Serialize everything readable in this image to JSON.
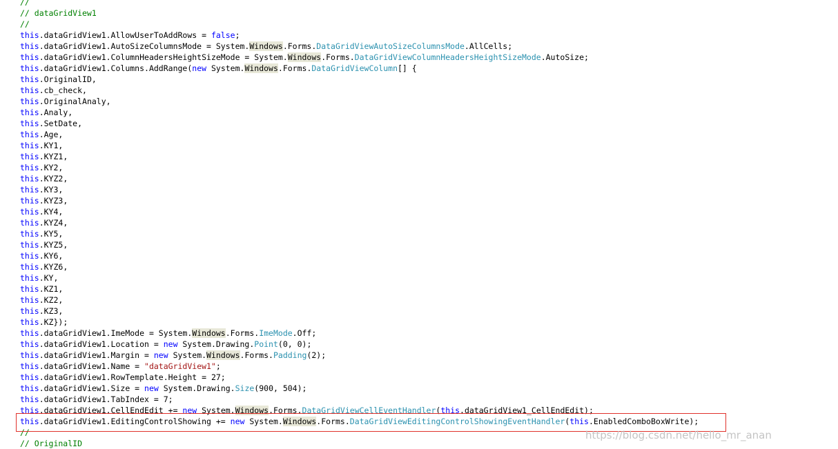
{
  "code": {
    "lines": [
      [
        [
          "cm",
          "//"
        ]
      ],
      [
        [
          "cm",
          "// dataGridView1"
        ]
      ],
      [
        [
          "cm",
          "//"
        ]
      ],
      [
        [
          "kw",
          "this"
        ],
        [
          "",
          ".dataGridView1.AllowUserToAddRows = "
        ],
        [
          "kw",
          "false"
        ],
        [
          "",
          ";"
        ]
      ],
      [
        [
          "kw",
          "this"
        ],
        [
          "",
          ".dataGridView1.AutoSizeColumnsMode = System."
        ],
        [
          "hl",
          "Windows"
        ],
        [
          "",
          ".Forms."
        ],
        [
          "ty",
          "DataGridViewAutoSizeColumnsMode"
        ],
        [
          "",
          ".AllCells;"
        ]
      ],
      [
        [
          "kw",
          "this"
        ],
        [
          "",
          ".dataGridView1.ColumnHeadersHeightSizeMode = System."
        ],
        [
          "hl",
          "Windows"
        ],
        [
          "",
          ".Forms."
        ],
        [
          "ty",
          "DataGridViewColumnHeadersHeightSizeMode"
        ],
        [
          "",
          ".AutoSize;"
        ]
      ],
      [
        [
          "kw",
          "this"
        ],
        [
          "",
          ".dataGridView1.Columns.AddRange("
        ],
        [
          "kw",
          "new"
        ],
        [
          "",
          " System."
        ],
        [
          "hl",
          "Windows"
        ],
        [
          "",
          ".Forms."
        ],
        [
          "ty",
          "DataGridViewColumn"
        ],
        [
          "",
          "[] {"
        ]
      ],
      [
        [
          "kw",
          "this"
        ],
        [
          "",
          ".OriginalID,"
        ]
      ],
      [
        [
          "kw",
          "this"
        ],
        [
          "",
          ".cb_check,"
        ]
      ],
      [
        [
          "kw",
          "this"
        ],
        [
          "",
          ".OriginalAnaly,"
        ]
      ],
      [
        [
          "kw",
          "this"
        ],
        [
          "",
          ".Analy,"
        ]
      ],
      [
        [
          "kw",
          "this"
        ],
        [
          "",
          ".SetDate,"
        ]
      ],
      [
        [
          "kw",
          "this"
        ],
        [
          "",
          ".Age,"
        ]
      ],
      [
        [
          "kw",
          "this"
        ],
        [
          "",
          ".KY1,"
        ]
      ],
      [
        [
          "kw",
          "this"
        ],
        [
          "",
          ".KYZ1,"
        ]
      ],
      [
        [
          "kw",
          "this"
        ],
        [
          "",
          ".KY2,"
        ]
      ],
      [
        [
          "kw",
          "this"
        ],
        [
          "",
          ".KYZ2,"
        ]
      ],
      [
        [
          "kw",
          "this"
        ],
        [
          "",
          ".KY3,"
        ]
      ],
      [
        [
          "kw",
          "this"
        ],
        [
          "",
          ".KYZ3,"
        ]
      ],
      [
        [
          "kw",
          "this"
        ],
        [
          "",
          ".KY4,"
        ]
      ],
      [
        [
          "kw",
          "this"
        ],
        [
          "",
          ".KYZ4,"
        ]
      ],
      [
        [
          "kw",
          "this"
        ],
        [
          "",
          ".KY5,"
        ]
      ],
      [
        [
          "kw",
          "this"
        ],
        [
          "",
          ".KYZ5,"
        ]
      ],
      [
        [
          "kw",
          "this"
        ],
        [
          "",
          ".KY6,"
        ]
      ],
      [
        [
          "kw",
          "this"
        ],
        [
          "",
          ".KYZ6,"
        ]
      ],
      [
        [
          "kw",
          "this"
        ],
        [
          "",
          ".KY,"
        ]
      ],
      [
        [
          "kw",
          "this"
        ],
        [
          "",
          ".KZ1,"
        ]
      ],
      [
        [
          "kw",
          "this"
        ],
        [
          "",
          ".KZ2,"
        ]
      ],
      [
        [
          "kw",
          "this"
        ],
        [
          "",
          ".KZ3,"
        ]
      ],
      [
        [
          "kw",
          "this"
        ],
        [
          "",
          ".KZ});"
        ]
      ],
      [
        [
          "kw",
          "this"
        ],
        [
          "",
          ".dataGridView1.ImeMode = System."
        ],
        [
          "hl",
          "Windows"
        ],
        [
          "",
          ".Forms."
        ],
        [
          "ty",
          "ImeMode"
        ],
        [
          "",
          ".Off;"
        ]
      ],
      [
        [
          "kw",
          "this"
        ],
        [
          "",
          ".dataGridView1.Location = "
        ],
        [
          "kw",
          "new"
        ],
        [
          "",
          " System.Drawing."
        ],
        [
          "ty",
          "Point"
        ],
        [
          "",
          "(0, 0);"
        ]
      ],
      [
        [
          "kw",
          "this"
        ],
        [
          "",
          ".dataGridView1.Margin = "
        ],
        [
          "kw",
          "new"
        ],
        [
          "",
          " System."
        ],
        [
          "hl",
          "Windows"
        ],
        [
          "",
          ".Forms."
        ],
        [
          "ty",
          "Padding"
        ],
        [
          "",
          "(2);"
        ]
      ],
      [
        [
          "kw",
          "this"
        ],
        [
          "",
          ".dataGridView1.Name = "
        ],
        [
          "st",
          "\"dataGridView1\""
        ],
        [
          "",
          ";"
        ]
      ],
      [
        [
          "kw",
          "this"
        ],
        [
          "",
          ".dataGridView1.RowTemplate.Height = 27;"
        ]
      ],
      [
        [
          "kw",
          "this"
        ],
        [
          "",
          ".dataGridView1.Size = "
        ],
        [
          "kw",
          "new"
        ],
        [
          "",
          " System.Drawing."
        ],
        [
          "ty",
          "Size"
        ],
        [
          "",
          "(900, 504);"
        ]
      ],
      [
        [
          "kw",
          "this"
        ],
        [
          "",
          ".dataGridView1.TabIndex = 7;"
        ]
      ],
      [
        [
          "kw",
          "this"
        ],
        [
          "",
          ".dataGridView1.CellEndEdit += "
        ],
        [
          "kw",
          "new"
        ],
        [
          "",
          " System."
        ],
        [
          "hl",
          "Windows"
        ],
        [
          "",
          ".Forms."
        ],
        [
          "ty",
          "DataGridViewCellEventHandler"
        ],
        [
          "",
          "("
        ],
        [
          "kw",
          "this"
        ],
        [
          "",
          ".dataGridView1_CellEndEdit);"
        ]
      ],
      [
        [
          "kw",
          "this"
        ],
        [
          "",
          ".dataGridView1.EditingControlShowing += "
        ],
        [
          "kw",
          "new"
        ],
        [
          "",
          " System."
        ],
        [
          "hl",
          "Windows"
        ],
        [
          "",
          ".Forms."
        ],
        [
          "ty",
          "DataGridViewEditingControlShowingEventHandler"
        ],
        [
          "",
          "("
        ],
        [
          "kw",
          "this"
        ],
        [
          "",
          ".EnabledComboBoxWrite);"
        ]
      ],
      [
        [
          "cm",
          "//"
        ]
      ],
      [
        [
          "cm",
          "// OriginalID"
        ]
      ]
    ]
  },
  "watermark": "https://blog.csdn.net/hello_mr_anan",
  "colors": {
    "keyword": "#0000ff",
    "type": "#2b91af",
    "comment": "#008000",
    "string": "#a31515",
    "word_highlight": "#e8e8d8",
    "annotation_box": "#e0302a"
  }
}
